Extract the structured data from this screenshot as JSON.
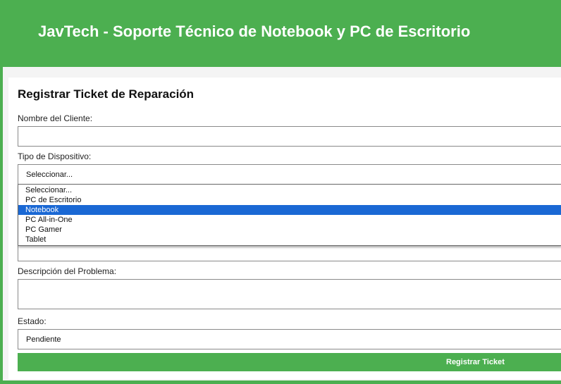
{
  "header": {
    "title": "JavTech - Soporte Técnico de Notebook y PC de Escritorio"
  },
  "form": {
    "title": "Registrar Ticket de Reparación",
    "cliente_label": "Nombre del Cliente:",
    "cliente_value": "",
    "dispositivo_label": "Tipo de Dispositivo:",
    "dispositivo_value": "Seleccionar...",
    "descripcion_label": "Descripción del Problema:",
    "descripcion_value": "",
    "estado_label": "Estado:",
    "estado_value": "Pendiente",
    "submit_label": "Registrar Ticket"
  },
  "dropdown": {
    "options": [
      {
        "label": "Seleccionar..."
      },
      {
        "label": "PC de Escritorio"
      },
      {
        "label": "Notebook"
      },
      {
        "label": "PC All-in-One"
      },
      {
        "label": "PC Gamer"
      },
      {
        "label": "Tablet"
      }
    ],
    "highlighted": "Notebook"
  },
  "colors": {
    "brand": "#4caf50",
    "highlight": "#1a68d4"
  }
}
